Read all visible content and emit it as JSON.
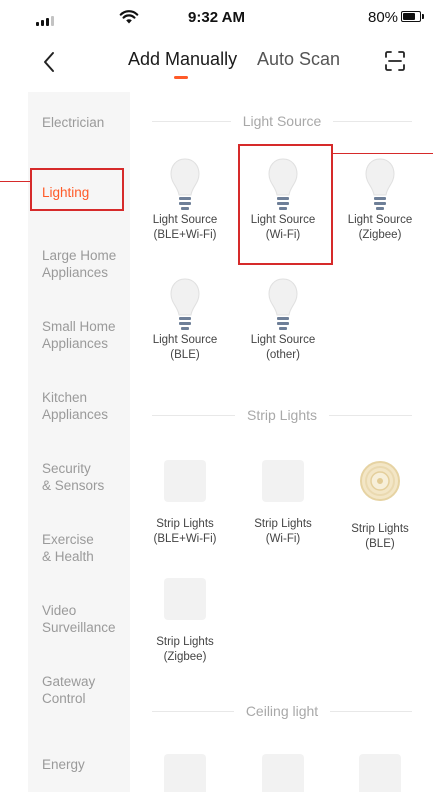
{
  "status_bar": {
    "time": "9:32 AM",
    "battery": "80%",
    "battery_level": 0.8
  },
  "nav": {
    "back_icon": "chevron-left-icon",
    "tabs": [
      {
        "label": "Add Manually",
        "active": true
      },
      {
        "label": "Auto Scan",
        "active": false
      }
    ],
    "scan_icon": "scan-frame-icon",
    "accent_color": "#ff5a28"
  },
  "sidebar": {
    "items": [
      {
        "line1": "Electrician",
        "line2": ""
      },
      {
        "line1": "Lighting",
        "line2": "",
        "active": true
      },
      {
        "line1": "Large Home",
        "line2": "Appliances"
      },
      {
        "line1": "Small Home",
        "line2": "Appliances"
      },
      {
        "line1": "Kitchen",
        "line2": "Appliances"
      },
      {
        "line1": "Security",
        "line2": "& Sensors"
      },
      {
        "line1": "Exercise",
        "line2": "& Health"
      },
      {
        "line1": "Video",
        "line2": "Surveillance"
      },
      {
        "line1": "Gateway",
        "line2": "Control"
      },
      {
        "line1": "Energy",
        "line2": ""
      }
    ]
  },
  "sections": {
    "light_source": {
      "title": "Light Source",
      "devices": [
        {
          "line1": "Light Source",
          "line2": "(BLE+Wi-Fi)",
          "icon": "light-bulb-icon"
        },
        {
          "line1": "Light Source",
          "line2": "(Wi-Fi)",
          "icon": "light-bulb-icon"
        },
        {
          "line1": "Light Source",
          "line2": "(Zigbee)",
          "icon": "light-bulb-icon"
        },
        {
          "line1": "Light Source",
          "line2": "(BLE)",
          "icon": "light-bulb-icon"
        },
        {
          "line1": "Light Source",
          "line2": "(other)",
          "icon": "light-bulb-icon"
        }
      ]
    },
    "strip_lights": {
      "title": "Strip Lights",
      "devices": [
        {
          "line1": "Strip Lights",
          "line2": "(BLE+Wi-Fi)",
          "icon": "image-placeholder-icon"
        },
        {
          "line1": "Strip Lights",
          "line2": "(Wi-Fi)",
          "icon": "image-placeholder-icon"
        },
        {
          "line1": "Strip Lights",
          "line2": "(BLE)",
          "icon": "strip-light-reel-icon"
        },
        {
          "line1": "Strip Lights",
          "line2": "(Zigbee)",
          "icon": "image-placeholder-icon"
        }
      ]
    },
    "ceiling_light": {
      "title": "Ceiling light"
    }
  },
  "annotation_color": "#d62a2a"
}
